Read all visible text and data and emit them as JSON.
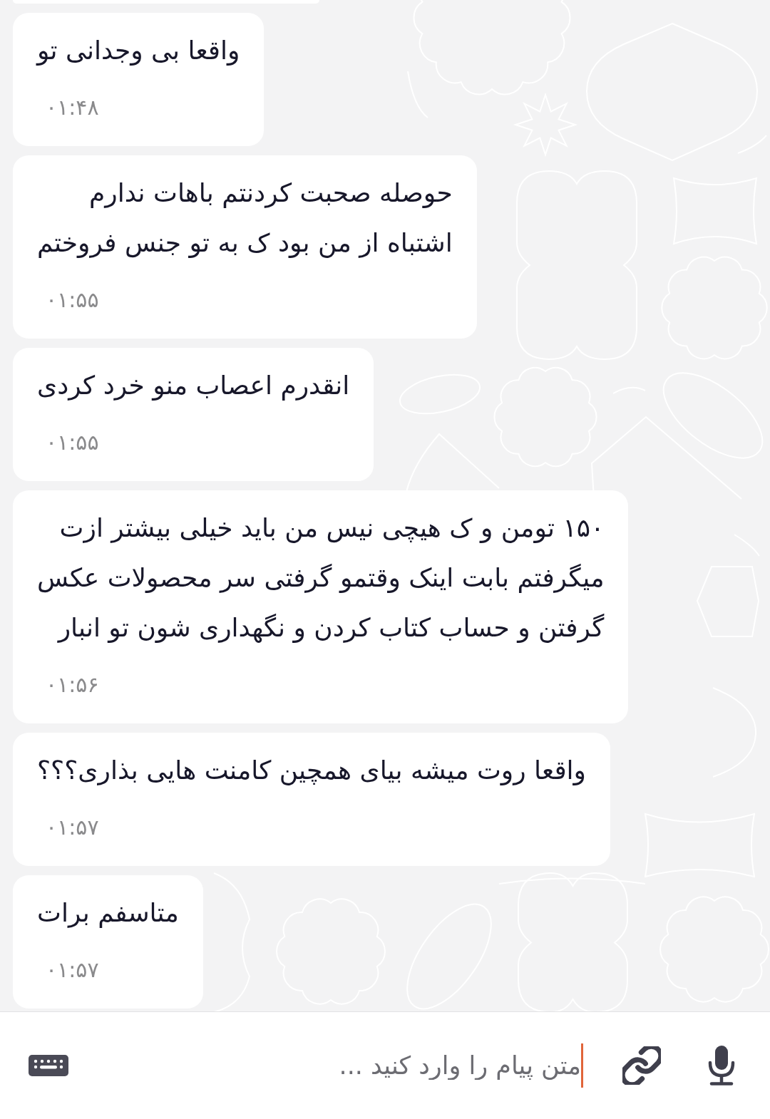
{
  "messages": [
    {
      "text": "واقعا بی وجدانی تو",
      "time": "۰۱:۴۸"
    },
    {
      "text": "حوصله صحبت کردنتم باهات ندارم\nاشتباه از من بود ک به تو جنس فروختم",
      "time": "۰۱:۵۵"
    },
    {
      "text": "انقدرم اعصاب منو خرد کردی",
      "time": "۰۱:۵۵"
    },
    {
      "text": "۱۵۰ تومن و ک هیچی نیس من باید خیلی بیشتر ازت\nمیگرفتم بابت اینک وقتمو گرفتی سر محصولات عکس\nگرفتن و حساب کتاب کردن و نگهداری شون تو انبار",
      "time": "۰۱:۵۶"
    },
    {
      "text": "واقعا روت میشه بیای همچین کامنت هایی بذاری؟؟؟",
      "time": "۰۱:۵۷"
    },
    {
      "text": "متاسفم برات",
      "time": "۰۱:۵۷"
    }
  ],
  "composer": {
    "placeholder": "متن پیام را وارد کنید ...",
    "focused": true
  }
}
